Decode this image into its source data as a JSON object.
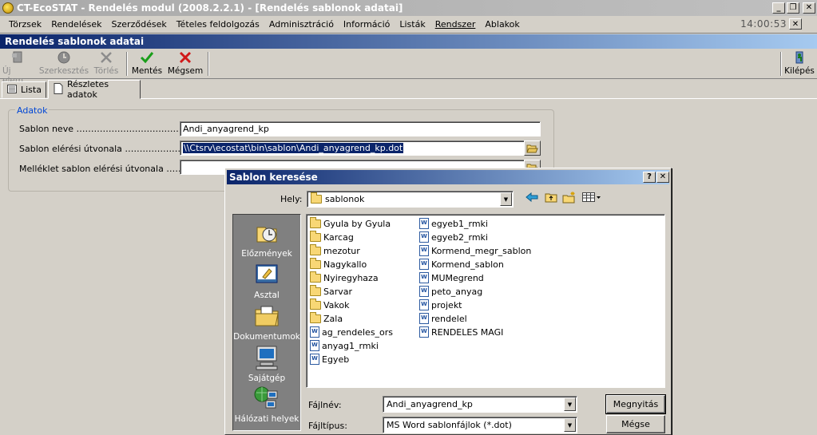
{
  "window": {
    "title": "CT-EcoSTAT - Rendelés modul (2008.2.2.1) - [Rendelés sablonok adatai]",
    "minimize": "_",
    "restore": "❐",
    "close": "✕"
  },
  "menubar": {
    "items": [
      "Törzsek",
      "Rendelések",
      "Szerződések",
      "Tételes feldolgozás",
      "Adminisztráció",
      "Információ",
      "Listák",
      "Rendszer",
      "Ablakok"
    ],
    "time": "14:00:53"
  },
  "child_window": {
    "title": "Rendelés sablonok adatai"
  },
  "toolbar": {
    "new_label": "Új elem",
    "edit_label": "Szerkesztés",
    "delete_label": "Törlés",
    "save_label": "Mentés",
    "cancel_label": "Mégsem",
    "exit_label": "Kilépés"
  },
  "tabs": [
    {
      "label": "Lista"
    },
    {
      "label": "Részletes adatok"
    }
  ],
  "form": {
    "group_title": "Adatok",
    "name_label": "Sablon neve ………………………………",
    "name_value": "Andi_anyagrend_kp",
    "path_label": "Sablon elérési útvonala …………………",
    "path_value": "\\\\Ctsrv\\ecostat\\bin\\sablon\\Andi_anyagrend_kp.dot",
    "attach_label": "Melléklet sablon elérési útvonala ………",
    "attach_value": ""
  },
  "dialog": {
    "title": "Sablon keresése",
    "help": "?",
    "close": "✕",
    "location_label": "Hely:",
    "location_value": "sablonok",
    "places": [
      {
        "label": "Előzmények",
        "icon": "history-icon"
      },
      {
        "label": "Asztal",
        "icon": "desktop-icon"
      },
      {
        "label": "Dokumentumok",
        "icon": "documents-icon"
      },
      {
        "label": "Sajátgép",
        "icon": "computer-icon"
      },
      {
        "label": "Hálózati helyek",
        "icon": "network-icon"
      }
    ],
    "files_col1": [
      {
        "name": "Gyula by Gyula",
        "type": "folder"
      },
      {
        "name": "Karcag",
        "type": "folder"
      },
      {
        "name": "mezotur",
        "type": "folder"
      },
      {
        "name": "Nagykallo",
        "type": "folder"
      },
      {
        "name": "Nyiregyhaza",
        "type": "folder"
      },
      {
        "name": "Sarvar",
        "type": "folder"
      },
      {
        "name": "Vakok",
        "type": "folder"
      },
      {
        "name": "Zala",
        "type": "folder"
      },
      {
        "name": "ag_rendeles_ors",
        "type": "doc"
      },
      {
        "name": "anyag1_rmki",
        "type": "doc"
      },
      {
        "name": "Egyeb",
        "type": "doc"
      }
    ],
    "files_col2": [
      {
        "name": "egyeb1_rmki",
        "type": "doc"
      },
      {
        "name": "egyeb2_rmki",
        "type": "doc"
      },
      {
        "name": "Kormend_megr_sablon",
        "type": "doc"
      },
      {
        "name": "Kormend_sablon",
        "type": "doc"
      },
      {
        "name": "MUMegrend",
        "type": "doc"
      },
      {
        "name": "peto_anyag",
        "type": "doc"
      },
      {
        "name": "projekt",
        "type": "doc"
      },
      {
        "name": "rendelel",
        "type": "doc"
      },
      {
        "name": "RENDELES MAGI",
        "type": "doc"
      }
    ],
    "filename_label": "Fájlnév:",
    "filename_value": "Andi_anyagrend_kp",
    "filetype_label": "Fájltípus:",
    "filetype_value": "MS Word sablonfájlok (*.dot)",
    "open_label": "Megnyitás",
    "cancel_label": "Mégse"
  }
}
